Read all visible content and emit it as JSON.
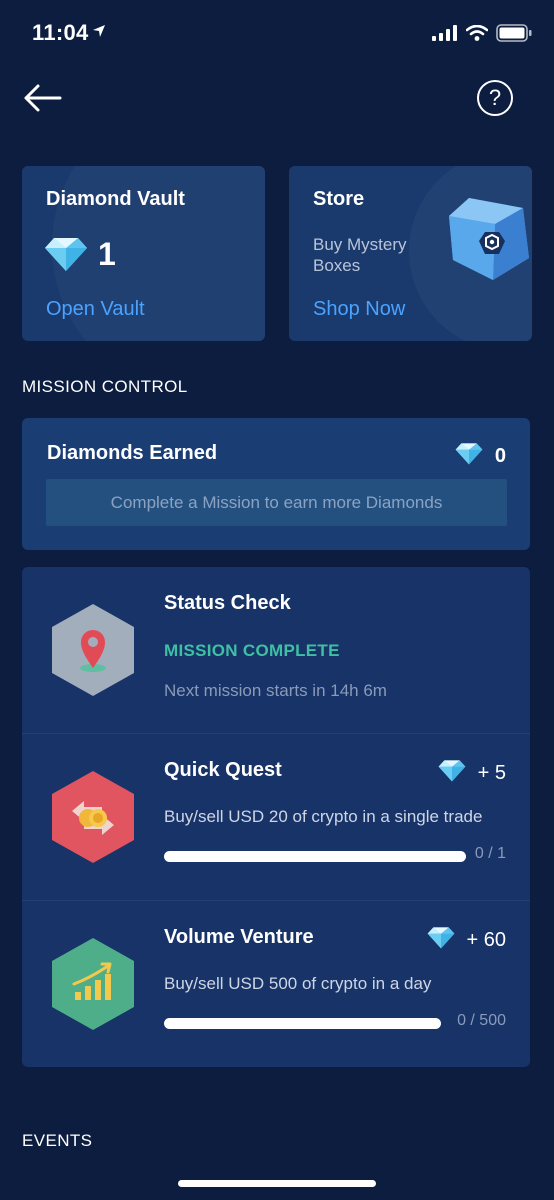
{
  "status_bar": {
    "time": "11:04"
  },
  "top_nav": {
    "help_label": "?"
  },
  "vault": {
    "title": "Diamond Vault",
    "count": "1",
    "link": "Open Vault"
  },
  "store": {
    "title": "Store",
    "subtitle": "Buy Mystery Boxes",
    "link": "Shop Now"
  },
  "sections": {
    "mission_control": "MISSION CONTROL",
    "events": "EVENTS"
  },
  "earned": {
    "title": "Diamonds Earned",
    "count": "0",
    "hint": "Complete a Mission to earn more Diamonds"
  },
  "missions": [
    {
      "title": "Status Check",
      "status": "MISSION COMPLETE",
      "note": "Next mission starts in 14h 6m",
      "icon": "location-pin-icon",
      "color": "#a3aebd"
    },
    {
      "title": "Quick Quest",
      "reward": "+ 5",
      "description": "Buy/sell USD 20 of crypto in a single trade",
      "progress": "0 / 1",
      "progress_fraction": 0,
      "icon": "exchange-coins-icon",
      "color": "#e0555f"
    },
    {
      "title": "Volume Venture",
      "reward": "+ 60",
      "description": "Buy/sell USD 500 of crypto in a day",
      "progress": "0 / 500",
      "progress_fraction": 0,
      "icon": "growth-chart-icon",
      "color": "#4fae8a"
    }
  ],
  "colors": {
    "background": "#0d1d3f",
    "card": "#1a3a6e",
    "link": "#4aa3ff",
    "success": "#3fc0a4",
    "diamond": "#7fd4f5"
  }
}
